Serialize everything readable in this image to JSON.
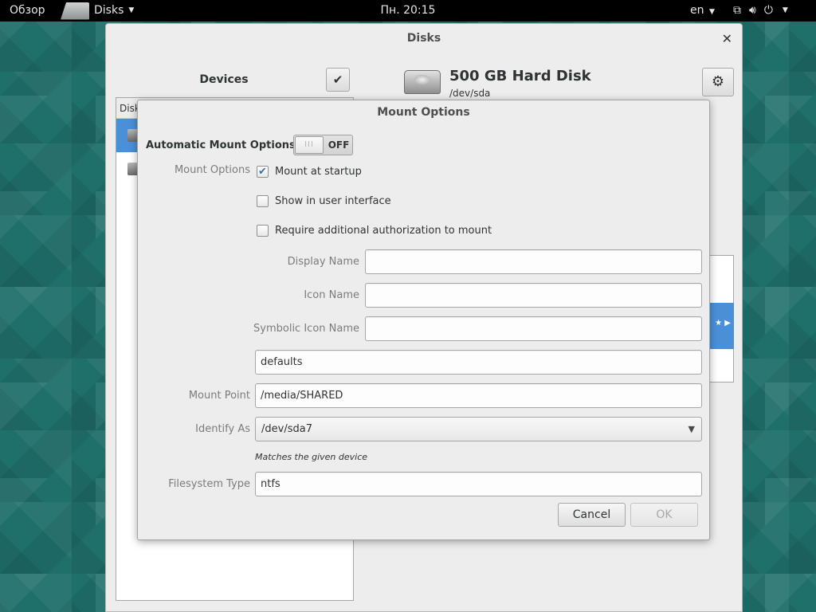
{
  "topbar": {
    "overview": "Обзор",
    "app_name": "Disks",
    "clock": "Пн. 20:15",
    "language": "en"
  },
  "window": {
    "title": "Disks",
    "devices_title": "Devices",
    "devices_list_header": "Disk",
    "disk_title": "500 GB Hard Disk",
    "disk_device": "/dev/sda"
  },
  "dialog": {
    "title": "Mount Options",
    "automatic_label": "Automatic Mount Options",
    "automatic_state": "OFF",
    "mount_options_label": "Mount Options",
    "mount_at_startup": "Mount at startup",
    "show_in_ui": "Show in user interface",
    "require_auth": "Require additional authorization to mount",
    "display_name_label": "Display Name",
    "display_name_value": "",
    "icon_name_label": "Icon Name",
    "icon_name_value": "",
    "symbolic_icon_label": "Symbolic Icon Name",
    "symbolic_icon_value": "",
    "options_value": "defaults",
    "mount_point_label": "Mount Point",
    "mount_point_value": "/media/SHARED",
    "identify_as_label": "Identify As",
    "identify_as_value": "/dev/sda7",
    "identify_hint": "Matches the given device",
    "fs_type_label": "Filesystem Type",
    "fs_type_value": "ntfs",
    "cancel_label": "Cancel",
    "ok_label": "OK"
  },
  "colors": {
    "selection": "#4a90d9",
    "topbar": "#000000",
    "desktop": "#1f6f6a",
    "checkbox_check": "#3d6eb5"
  }
}
